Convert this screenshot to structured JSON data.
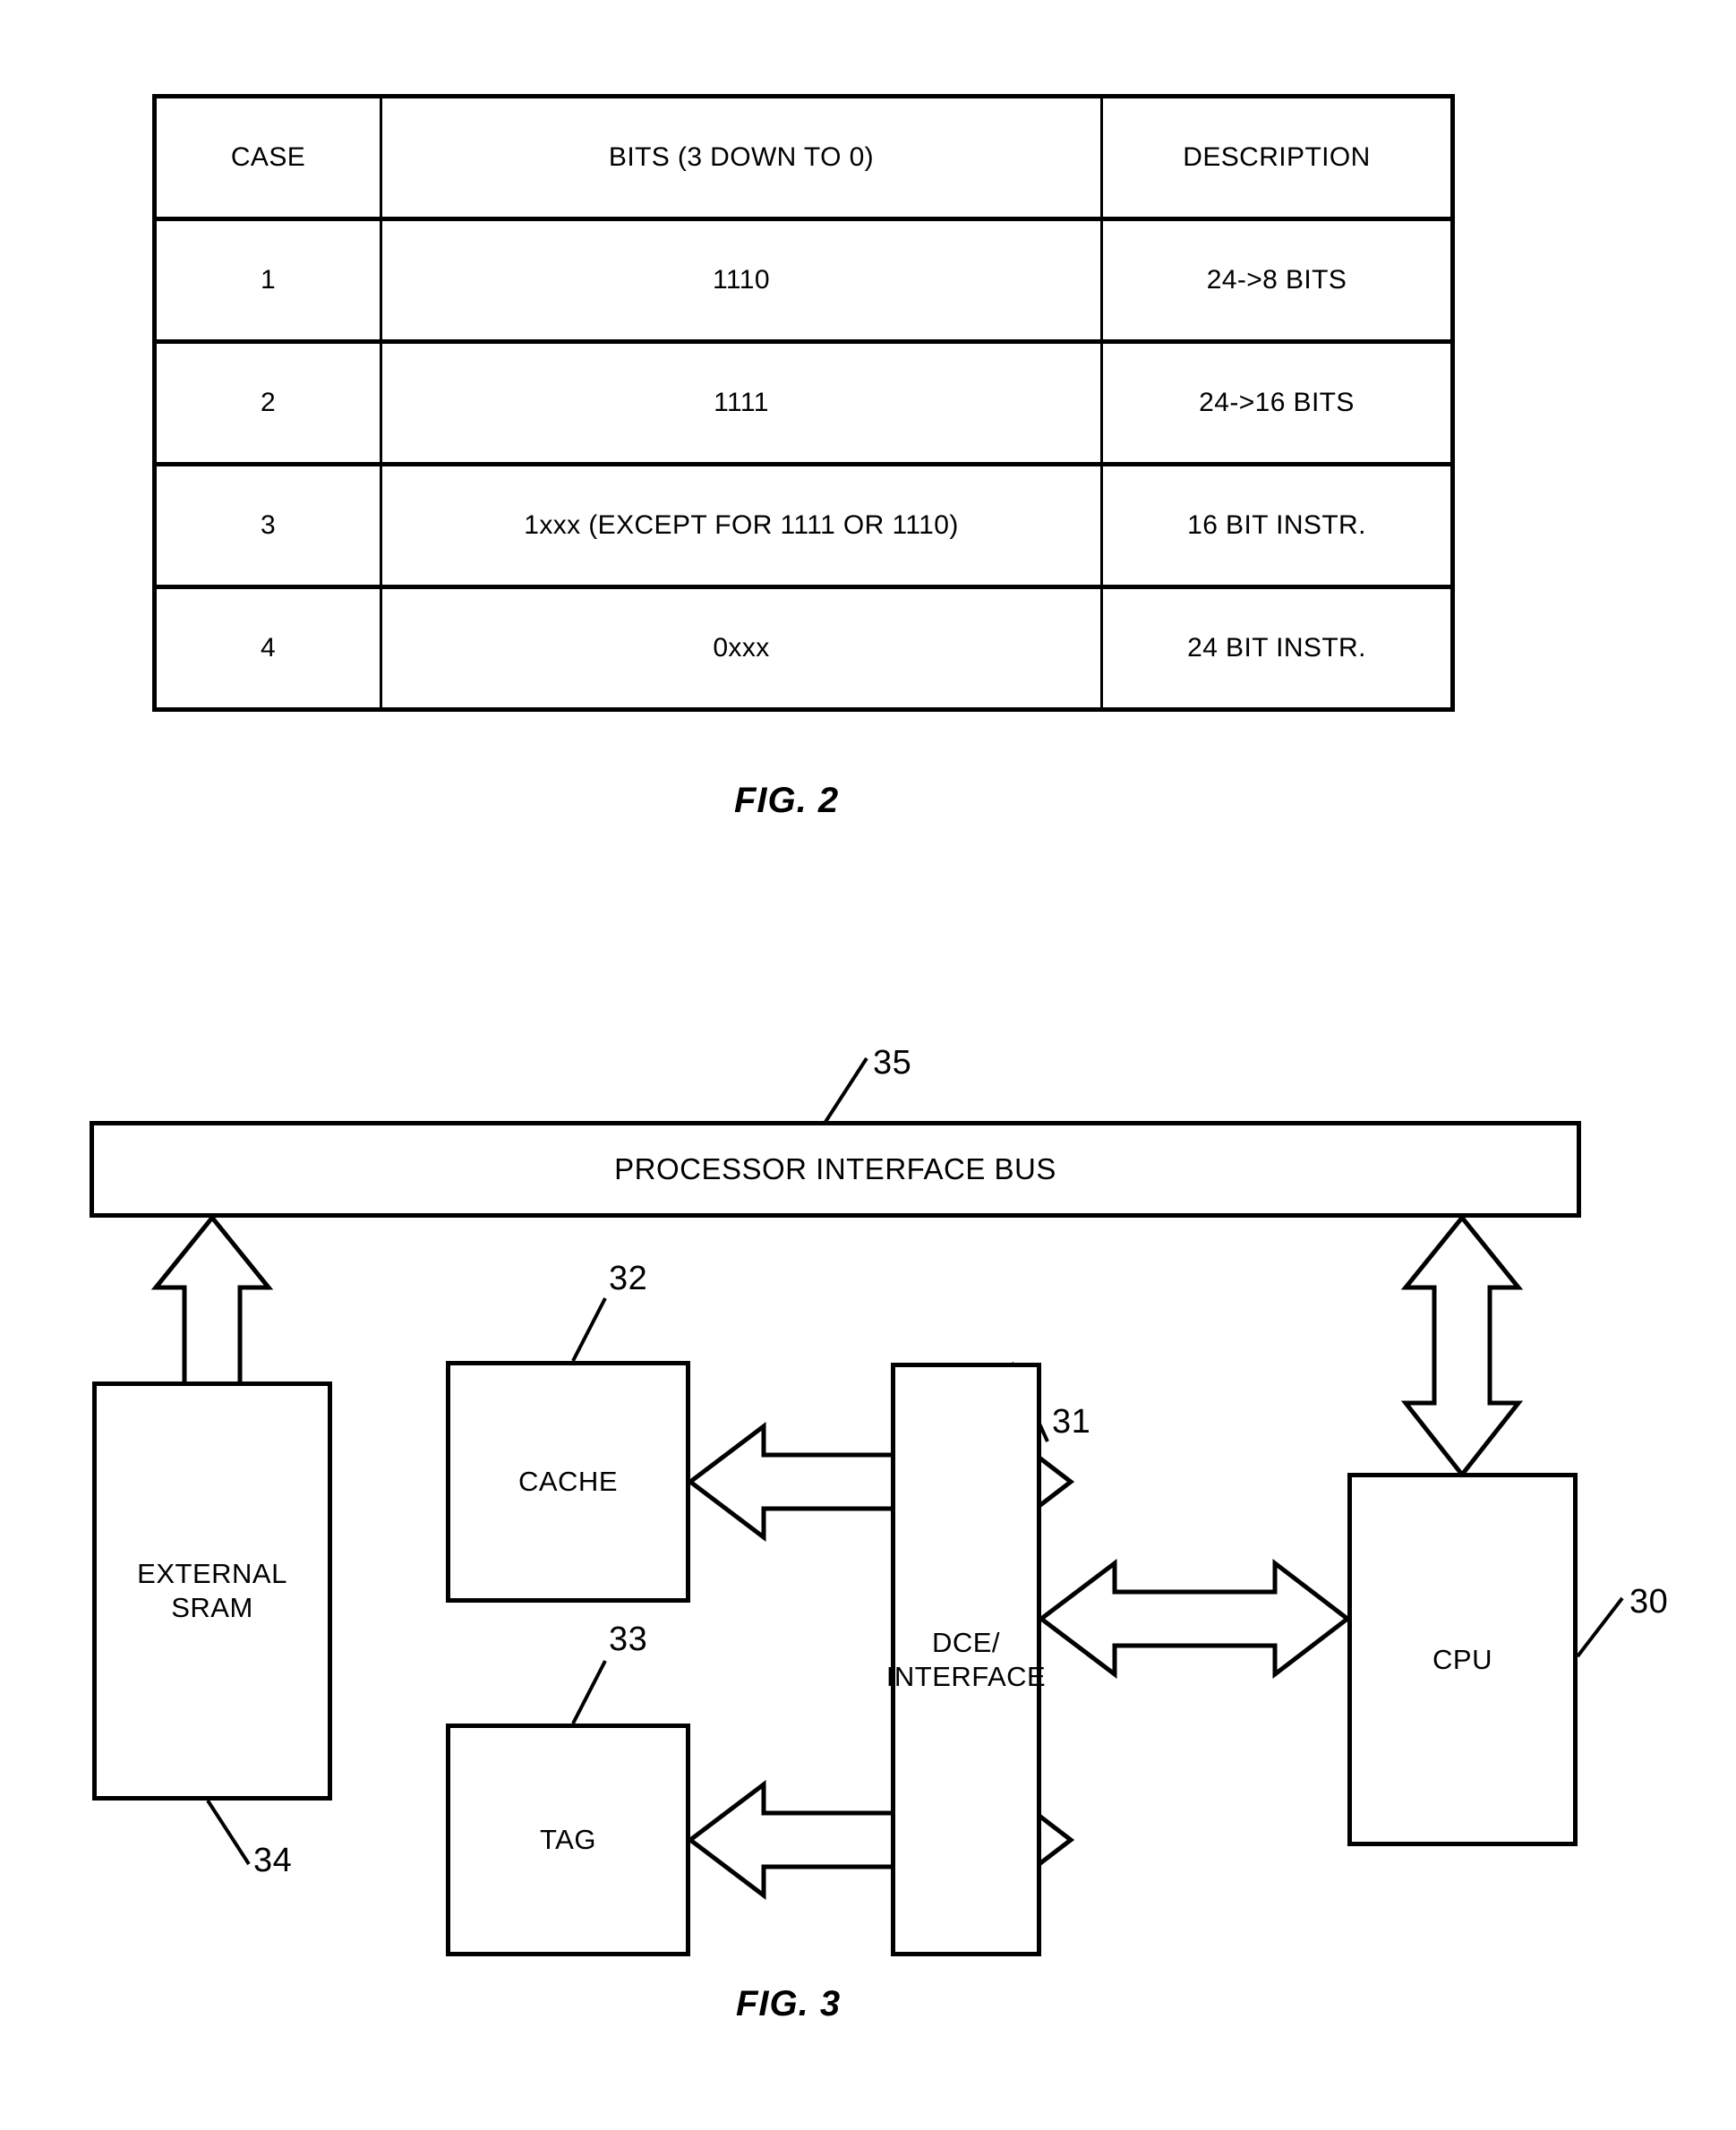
{
  "figure2": {
    "caption": "FIG. 2",
    "table": {
      "headers": [
        "CASE",
        "BITS (3 DOWN TO 0)",
        "DESCRIPTION"
      ],
      "rows": [
        {
          "case": "1",
          "bits": "1110",
          "description": "24->8 BITS"
        },
        {
          "case": "2",
          "bits": "1111",
          "description": "24->16 BITS"
        },
        {
          "case": "3",
          "bits": "1xxx (EXCEPT FOR 1111 OR 1110)",
          "description": "16 BIT INSTR."
        },
        {
          "case": "4",
          "bits": "0xxx",
          "description": "24 BIT INSTR."
        }
      ]
    }
  },
  "figure3": {
    "caption": "FIG. 3",
    "blocks": {
      "bus": {
        "label": "PROCESSOR INTERFACE BUS",
        "ref": "35"
      },
      "sram": {
        "label_line1": "EXTERNAL",
        "label_line2": "SRAM",
        "ref": "34"
      },
      "cache": {
        "label": "CACHE",
        "ref": "32"
      },
      "tag": {
        "label": "TAG",
        "ref": "33"
      },
      "dce": {
        "label_line1": "DCE/",
        "label_line2": "INTERFACE",
        "ref": "31"
      },
      "cpu": {
        "label": "CPU",
        "ref": "30"
      }
    },
    "connectors": [
      {
        "name": "bus-to-sram",
        "style": "double-headed-vertical"
      },
      {
        "name": "bus-to-cpu",
        "style": "double-headed-vertical"
      },
      {
        "name": "cache-to-dce",
        "style": "double-headed-horizontal"
      },
      {
        "name": "tag-to-dce",
        "style": "double-headed-horizontal"
      },
      {
        "name": "dce-to-cpu",
        "style": "double-headed-horizontal"
      }
    ]
  },
  "colors": {
    "ink": "#000000",
    "page": "#ffffff"
  }
}
